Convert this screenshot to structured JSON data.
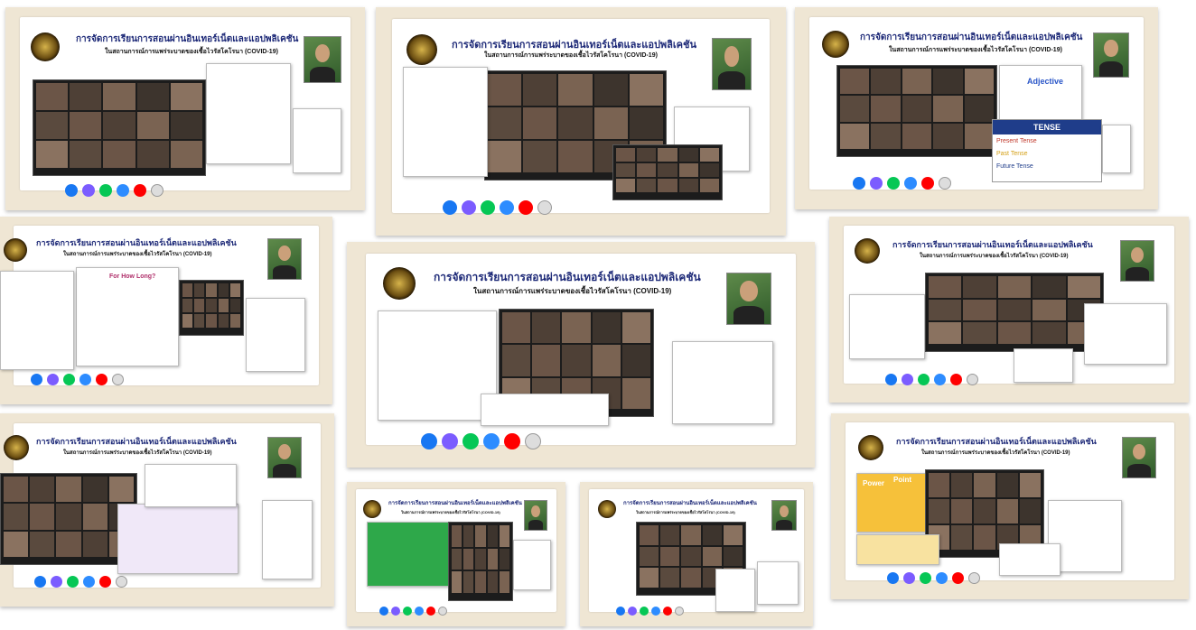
{
  "posters": [
    {
      "title": "การจัดการเรียนการสอนผ่านอินเทอร์เน็ตและแอปพลิเคชัน",
      "subtitle": "ในสถานการณ์การแพร่ระบาดของเชื้อไวรัสโคโรนา (COVID-19)"
    },
    {
      "title": "การจัดการเรียนการสอนผ่านอินเทอร์เน็ตและแอปพลิเคชัน",
      "subtitle": "ในสถานการณ์การแพร่ระบาดของเชื้อไวรัสโคโรนา (COVID-19)"
    },
    {
      "title": "การจัดการเรียนการสอนผ่านอินเทอร์เน็ตและแอปพลิเคชัน",
      "subtitle": "ในสถานการณ์การแพร่ระบาดของเชื้อไวรัสโคโรนา (COVID-19)"
    },
    {
      "title": "การจัดการเรียนการสอนผ่านอินเทอร์เน็ตและแอปพลิเคชัน",
      "subtitle": "ในสถานการณ์การแพร่ระบาดของเชื้อไวรัสโคโรนา (COVID-19)"
    },
    {
      "title": "การจัดการเรียนการสอนผ่านอินเทอร์เน็ตและแอปพลิเคชัน",
      "subtitle": "ในสถานการณ์การแพร่ระบาดของเชื้อไวรัสโคโรนา (COVID-19)"
    },
    {
      "title": "การจัดการเรียนการสอนผ่านอินเทอร์เน็ตและแอปพลิเคชัน",
      "subtitle": "ในสถานการณ์การแพร่ระบาดของเชื้อไวรัสโคโรนา (COVID-19)"
    },
    {
      "title": "การจัดการเรียนการสอนผ่านอินเทอร์เน็ตและแอปพลิเคชัน",
      "subtitle": "ในสถานการณ์การแพร่ระบาดของเชื้อไวรัสโคโรนา (COVID-19)"
    },
    {
      "title": "การจัดการเรียนการสอนผ่านอินเทอร์เน็ตและแอปพลิเคชัน",
      "subtitle": "ในสถานการณ์การแพร่ระบาดของเชื้อไวรัสโคโรนา (COVID-19)"
    },
    {
      "title": "การจัดการเรียนการสอนผ่านอินเทอร์เน็ตและแอปพลิเคชัน",
      "subtitle": "ในสถานการณ์การแพร่ระบาดของเชื้อไวรัสโคโรนา (COVID-19)"
    },
    {
      "title": "การจัดการเรียนการสอนผ่านอินเทอร์เน็ตและแอปพลิเคชัน",
      "subtitle": "ในสถานการณ์การแพร่ระบาดของเชื้อไวรัสโคโรนา (COVID-19)"
    }
  ],
  "slide_text": {
    "adjective": "Adjective",
    "tense_title": "TENSE",
    "tense_present": "Present Tense",
    "tense_past": "Past Tense",
    "tense_future": "Future Tense",
    "for_how_long": "For How Long?",
    "power": "Power",
    "point": "Point"
  },
  "app_icons": [
    "facebook-icon",
    "messenger-icon",
    "line-icon",
    "zoom-icon",
    "youtube-icon",
    "google-icon"
  ],
  "colors": {
    "card_bg": "#efe6d4",
    "title_blue": "#1e2a78",
    "facebook": "#1877f2",
    "messenger": "#7b5cff",
    "line": "#06c755",
    "zoom": "#2d8cff",
    "youtube": "#ff0000",
    "google": "#9e9e9e"
  }
}
